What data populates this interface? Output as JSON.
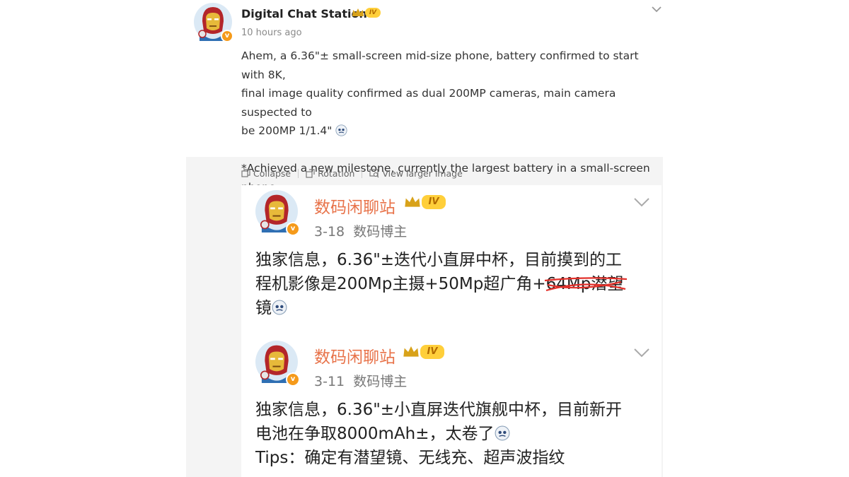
{
  "post": {
    "author": "Digital Chat Station",
    "level": "IV",
    "time": "10 hours ago",
    "lines": [
      "Ahem, a 6.36\"± small-screen mid-size phone, battery confirmed to start with 8K,",
      "final image quality confirmed as dual 200MP cameras, main camera suspected to",
      "be 200MP 1/1.4\"",
      "*Achieved a new milestone, currently the largest battery in a small-screen phone",
      "✓"
    ]
  },
  "toolbar": {
    "collapse": "Collapse",
    "rotation": "Rotation",
    "view_larger": "View larger image"
  },
  "embedded": {
    "posts": [
      {
        "name": "数码闲聊站",
        "level": "IV",
        "date": "3-18",
        "role": "数码博主",
        "line1": "独家信息，6.36\"±迭代小直屏中杯，目前摸到的工",
        "line2_pre": "程机影像是200Mp主摄+50Mp超广角+",
        "line2_struck": "64Mp潜望",
        "line3": "镜"
      },
      {
        "name": "数码闲聊站",
        "level": "IV",
        "date": "3-11",
        "role": "数码博主",
        "line1": "独家信息，6.36\"±小直屏迭代旗舰中杯，目前新开",
        "line2": "电池在争取8000mAh±，太卷了",
        "line3": "Tips：确定有潜望镜、无线充、超声波指纹"
      }
    ]
  },
  "colors": {
    "accent_orange": "#e8734a",
    "badge_gold": "#ffcf3a",
    "verified": "#f59a1a"
  },
  "icons": [
    "avatar-ironman-icon",
    "verified-icon",
    "crown-icon",
    "chevron-down-icon",
    "collapse-icon",
    "rotation-icon",
    "view-larger-icon",
    "emoji-icon",
    "strike-mark"
  ]
}
